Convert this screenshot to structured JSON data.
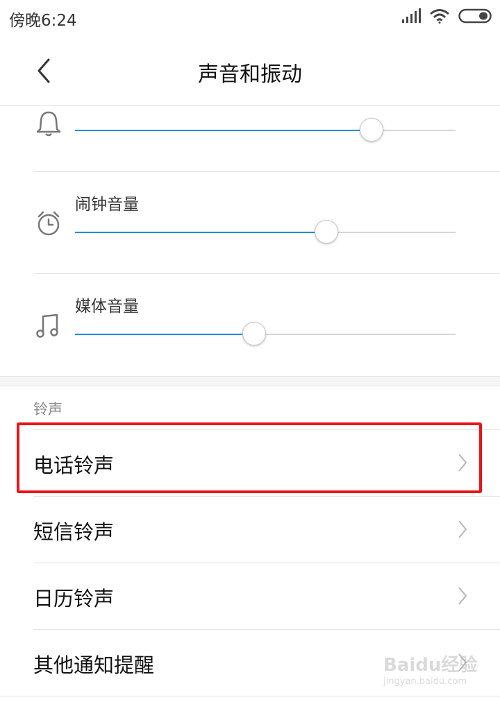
{
  "status_bar": {
    "time": "傍晚6:24",
    "icons": [
      "signal-icon",
      "wifi-icon",
      "battery-icon"
    ]
  },
  "header": {
    "title": "声音和振动",
    "back_icon": "chevron-left-icon"
  },
  "volume_sliders": [
    {
      "name": "ringtone",
      "label": "",
      "icon": "bell-icon",
      "level": 0.78
    },
    {
      "name": "alarm",
      "label": "闹钟音量",
      "icon": "alarm-clock-icon",
      "level": 0.66
    },
    {
      "name": "media",
      "label": "媒体音量",
      "icon": "music-note-icon",
      "level": 0.47
    }
  ],
  "ringtones_section": {
    "header": "铃声",
    "items": [
      {
        "label": "电话铃声"
      },
      {
        "label": "短信铃声"
      },
      {
        "label": "日历铃声"
      },
      {
        "label": "其他通知提醒"
      }
    ]
  },
  "annotation": {
    "highlight_color": "#e8141a"
  },
  "colors": {
    "accent": "#0e8fd7",
    "track": "#d6d6d6"
  },
  "watermark": {
    "logo": "Baidu经验",
    "url": "jingyan.baidu.com"
  }
}
